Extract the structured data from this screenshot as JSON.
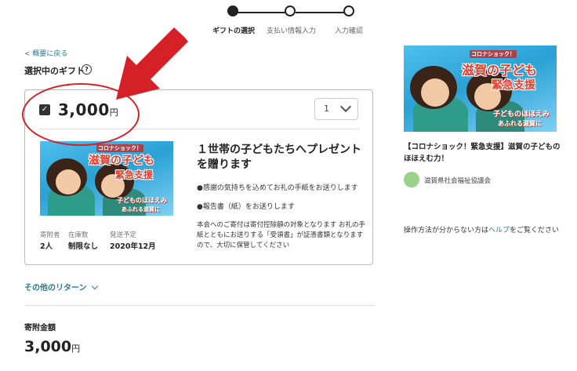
{
  "steps": [
    {
      "label": "ギフトの選択",
      "state": "active"
    },
    {
      "label": "支払い情報入力",
      "state": "todo"
    },
    {
      "label": "入力確認",
      "state": "todo"
    }
  ],
  "back_link": "< 概要に戻る",
  "selected_gift_label": "選択中のギフト",
  "help_icon": "?",
  "gift": {
    "checked": true,
    "check_glyph": "✓",
    "price": "3,000",
    "price_unit": "円",
    "quantity": "1",
    "title": "１世帯の子どもたちへプレゼントを贈ります",
    "bullets": [
      "●感謝の気持ちを込めてお礼の手紙をお送りします",
      "●報告書（紙）をお送りします"
    ],
    "description": "本会へのご寄付は寄付控除額の対象となります お礼の手紙とともにお送りする「受領書」が証憑書類となりますので、大切に保管してください",
    "meta": [
      {
        "label": "寄附者",
        "value": "2人"
      },
      {
        "label": "在庫数",
        "value": "制限なし"
      },
      {
        "label": "発送予定",
        "value": "2020年12月"
      }
    ]
  },
  "promo_image": {
    "small_tag": "コロナショック！",
    "line1": "滋賀の子ども",
    "line2": "緊急支援",
    "line3": "子どものほほえみ",
    "line4": "あふれる滋賀に"
  },
  "other_returns": "その他のリターン",
  "amount_label": "寄附金額",
  "amount": "3,000",
  "amount_unit": "円",
  "sidebar": {
    "project_title": "【コロナショック！緊急支援】滋賀の子どものほほえむ力！",
    "org_name": "滋賀県社会福祉協議会",
    "help_prefix": "操作方法が分からない方は",
    "help_link": "ヘルプ",
    "help_suffix": "をご覧ください"
  },
  "colors": {
    "accent": "#2a7b8c",
    "annotation": "#d62027"
  }
}
